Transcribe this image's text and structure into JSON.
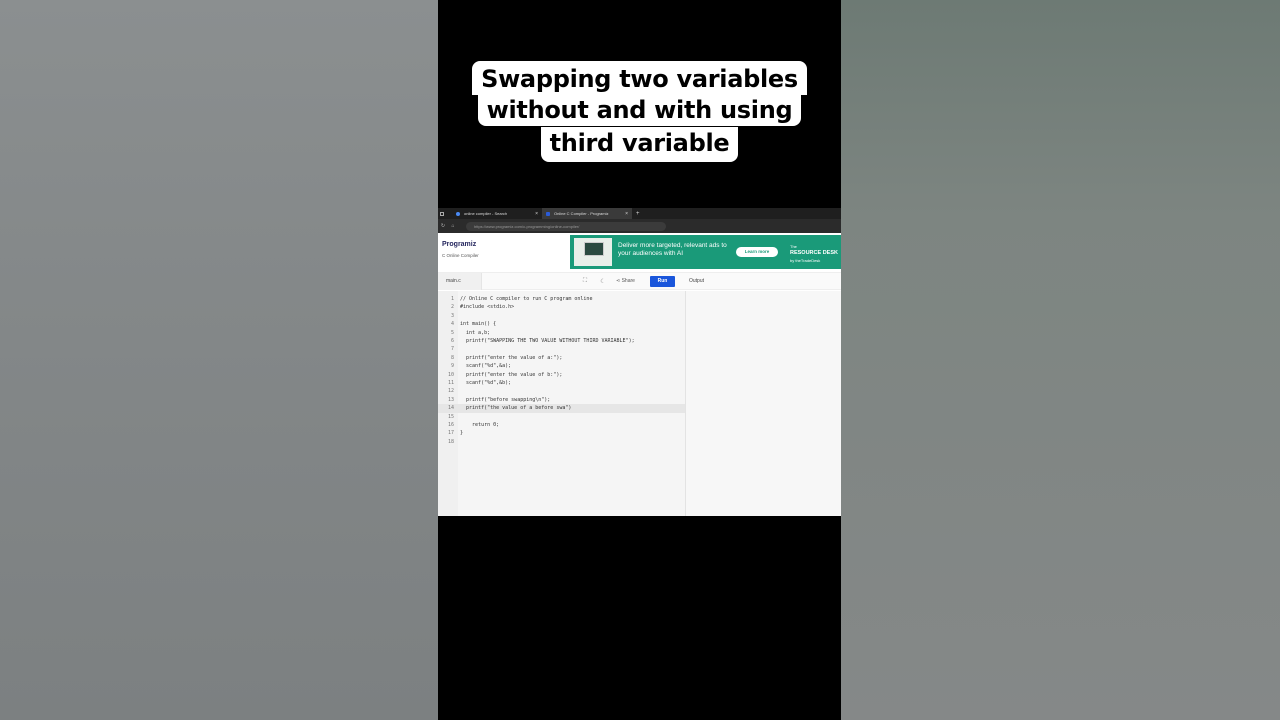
{
  "caption": {
    "line1": "Swapping two variables",
    "line2": "without and with using",
    "line3": "third variable"
  },
  "browser": {
    "tabs": [
      {
        "title": "online compiler - Search",
        "active": false
      },
      {
        "title": "Online C Compiler - Programiz",
        "active": true
      }
    ],
    "new_tab": "+",
    "url": "https://www.programiz.com/c-programming/online-compiler/"
  },
  "site": {
    "logo": "Programiz",
    "subtitle": "C Online Compiler"
  },
  "ad": {
    "text": "Deliver more targeted, relevant ads to your audiences with AI",
    "button": "Learn more",
    "brand_top": "The",
    "brand": "RESOURCE DESK",
    "brand_sub": "by theTradeDesk"
  },
  "toolbar": {
    "file_tab": "main.c",
    "share": "Share",
    "run": "Run",
    "output": "Output"
  },
  "code_lines": [
    {
      "n": "1",
      "text": "// Online C compiler to run C program online"
    },
    {
      "n": "2",
      "text": "#include <stdio.h>"
    },
    {
      "n": "3",
      "text": ""
    },
    {
      "n": "4",
      "text": "int main() {"
    },
    {
      "n": "5",
      "text": "  int a,b;"
    },
    {
      "n": "6",
      "text": "  printf(\"SWAPPING THE TWO VALUE WITHOUT THIRD VARIABLE\");"
    },
    {
      "n": "7",
      "text": ""
    },
    {
      "n": "8",
      "text": "  printf(\"enter the value of a:\");"
    },
    {
      "n": "9",
      "text": "  scanf(\"%d\",&a);"
    },
    {
      "n": "10",
      "text": "  printf(\"enter the value of b:\");"
    },
    {
      "n": "11",
      "text": "  scanf(\"%d\",&b);"
    },
    {
      "n": "12",
      "text": ""
    },
    {
      "n": "13",
      "text": "  printf(\"before swapping\\n\");"
    },
    {
      "n": "14",
      "text": "  printf(\"the value of a before swa\")"
    },
    {
      "n": "15",
      "text": ""
    },
    {
      "n": "16",
      "text": "    return 0;"
    },
    {
      "n": "17",
      "text": "}"
    },
    {
      "n": "18",
      "text": ""
    }
  ],
  "highlighted_line": "14",
  "colors": {
    "run_button": "#1a56db",
    "ad_background": "#1a9a79",
    "logo": "#25265e"
  }
}
